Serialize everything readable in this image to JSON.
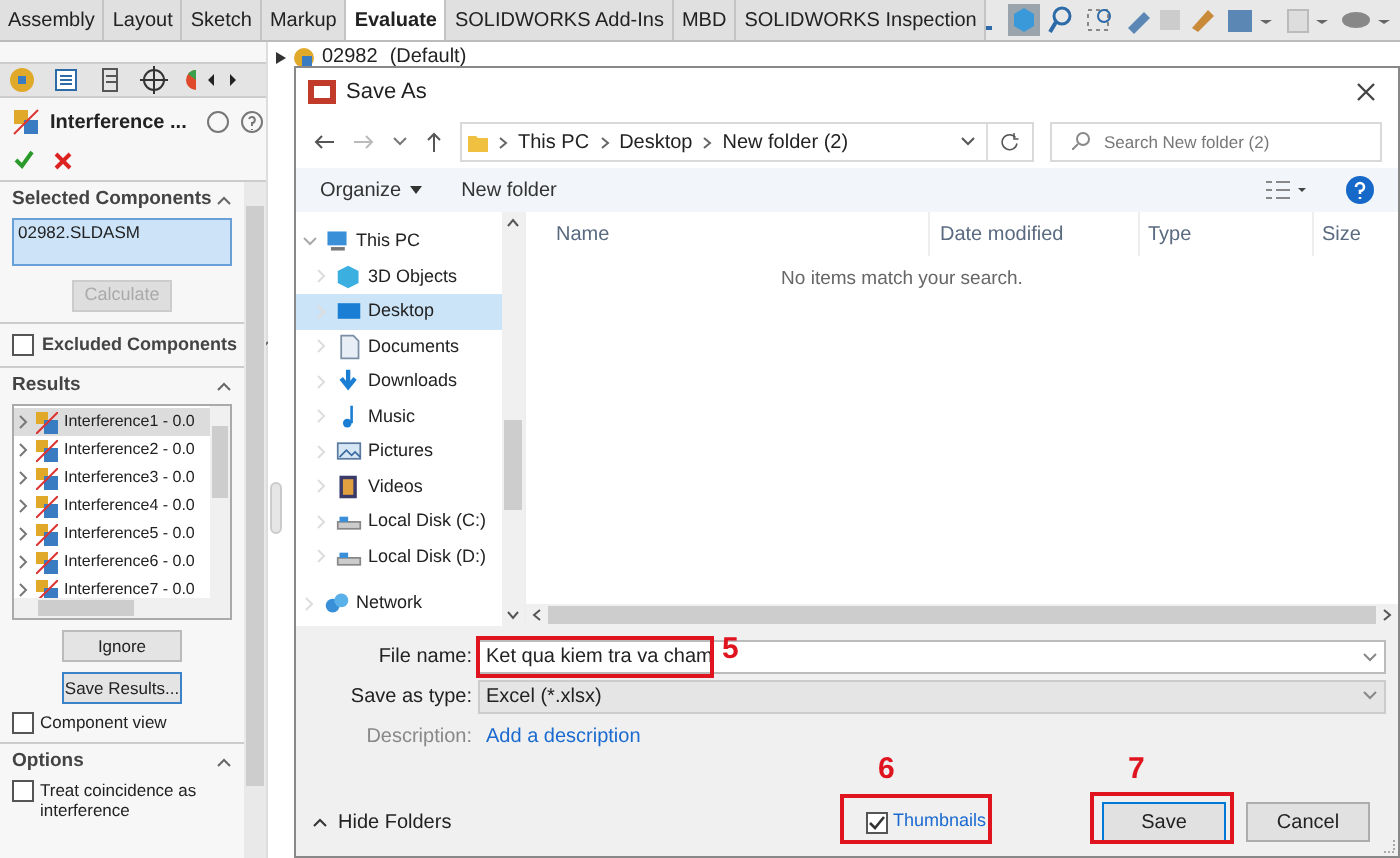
{
  "command_tabs": [
    {
      "label": "Assembly",
      "selected": false
    },
    {
      "label": "Layout",
      "selected": false
    },
    {
      "label": "Sketch",
      "selected": false
    },
    {
      "label": "Markup",
      "selected": false
    },
    {
      "label": "Evaluate",
      "selected": true
    },
    {
      "label": "SOLIDWORKS Add-Ins",
      "selected": false
    },
    {
      "label": "MBD",
      "selected": false
    },
    {
      "label": "SOLIDWORKS Inspection",
      "selected": false
    }
  ],
  "property_manager": {
    "title": "Interference ...",
    "selected_components": {
      "heading": "Selected Components",
      "items": [
        "02982.SLDASM"
      ],
      "button": {
        "label": "Calculate",
        "disabled": true
      }
    },
    "excluded_components": {
      "heading": "Excluded Components",
      "checked": false
    },
    "results": {
      "heading": "Results",
      "items": [
        {
          "label": "Interference1 - 0.0",
          "selected": true
        },
        {
          "label": "Interference2 - 0.0",
          "selected": false
        },
        {
          "label": "Interference3 - 0.0",
          "selected": false
        },
        {
          "label": "Interference4 - 0.0",
          "selected": false
        },
        {
          "label": "Interference5 - 0.0",
          "selected": false
        },
        {
          "label": "Interference6 - 0.0",
          "selected": false
        },
        {
          "label": "Interference7 - 0.0",
          "selected": false
        }
      ],
      "buttons": [
        "Ignore",
        "Save Results..."
      ],
      "component_view": {
        "label": "Component view",
        "checked": false
      }
    },
    "options": {
      "heading": "Options",
      "items": [
        {
          "label": "Treat coincidence as interference",
          "checked": false
        }
      ]
    }
  },
  "feature_tree": {
    "label": "02982",
    "configuration": "(Default)"
  },
  "dialog": {
    "title": "Save As",
    "breadcrumb": [
      "This PC",
      "Desktop",
      "New folder (2)"
    ],
    "search": {
      "placeholder": "Search New folder (2)"
    },
    "toolbar": [
      "Organize",
      "New folder"
    ],
    "nav_tree": [
      {
        "label": "This PC",
        "kind": "pc",
        "expanded": true,
        "selected": false,
        "children": [
          {
            "label": "3D Objects",
            "kind": "objects",
            "selected": false
          },
          {
            "label": "Desktop",
            "kind": "desktop",
            "selected": true
          },
          {
            "label": "Documents",
            "kind": "documents",
            "selected": false
          },
          {
            "label": "Downloads",
            "kind": "downloads",
            "selected": false
          },
          {
            "label": "Music",
            "kind": "music",
            "selected": false
          },
          {
            "label": "Pictures",
            "kind": "pictures",
            "selected": false
          },
          {
            "label": "Videos",
            "kind": "videos",
            "selected": false
          },
          {
            "label": "Local Disk (C:)",
            "kind": "disk",
            "selected": false
          },
          {
            "label": "Local Disk (D:)",
            "kind": "disk",
            "selected": false
          }
        ]
      },
      {
        "label": "Network",
        "kind": "network",
        "selected": false
      }
    ],
    "columns": [
      "Name",
      "Date modified",
      "Type",
      "Size"
    ],
    "empty_message": "No items match your search.",
    "fields": [
      {
        "label": "File name:",
        "value": "Ket qua kiem tra va cham",
        "kind": "input"
      },
      {
        "label": "Save as type:",
        "value": "Excel (*.xlsx)",
        "kind": "select"
      },
      {
        "label": "Description:",
        "value": "Add a description",
        "kind": "link"
      }
    ],
    "hide_folders": "Hide Folders",
    "thumbnails": {
      "label": "Thumbnails",
      "checked": true
    },
    "buttons": [
      "Save",
      "Cancel"
    ]
  },
  "annotations": [
    {
      "label": "5"
    },
    {
      "label": "6"
    },
    {
      "label": "7"
    }
  ]
}
